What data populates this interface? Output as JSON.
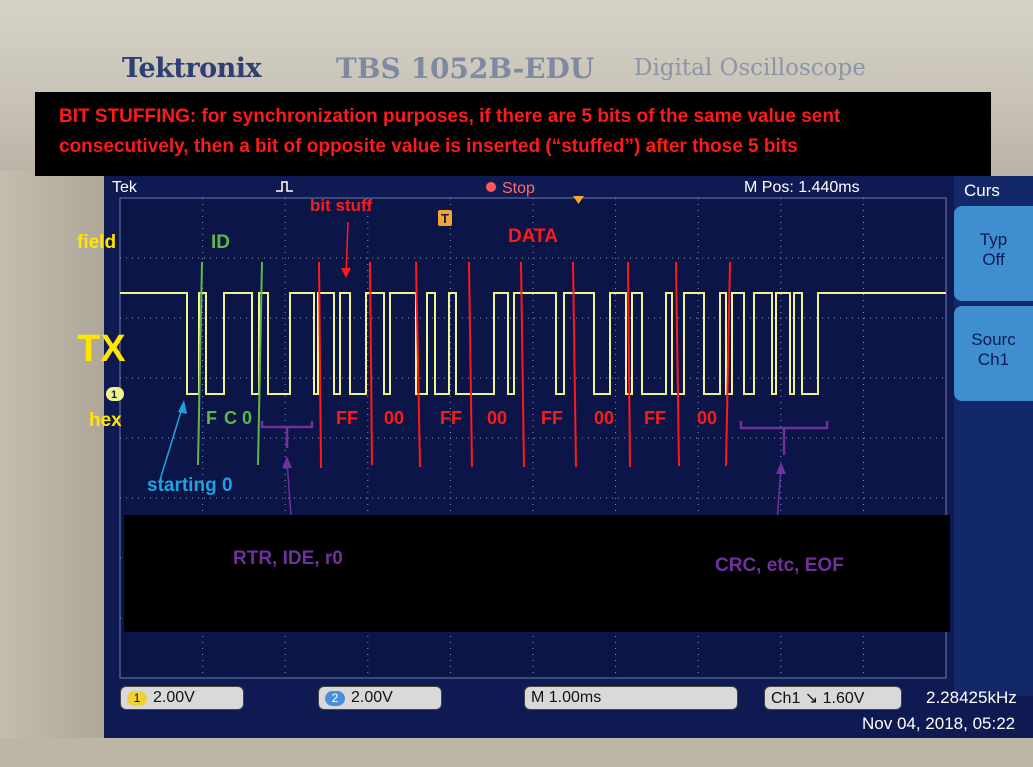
{
  "instrument": {
    "brand": "Tektronix",
    "model": "TBS 1052B-EDU",
    "product": "Digital Oscilloscope"
  },
  "note": {
    "line1": "BIT STUFFING: for synchronization purposes, if there are 5 bits of the same value sent",
    "line2": "consecutively, then a bit of opposite value is inserted (“stuffed”) after those 5 bits"
  },
  "screen": {
    "brand_short": "Tek",
    "run_state": "Stop",
    "m_pos": "M Pos: 1.440ms",
    "trigger_marker": "T",
    "channel_marker": "1",
    "menu": {
      "title": "Curs",
      "type_label": "Typ",
      "type_value": "Off",
      "source_label": "Sourc",
      "source_value": "Ch1"
    },
    "bottom": {
      "ch1_badge": "1",
      "ch1_scale": "2.00V",
      "ch2_badge": "2",
      "ch2_scale": "2.00V",
      "timebase": "M 1.00ms",
      "trigger": "Ch1 ↘ 1.60V",
      "frequency": "2.28425kHz",
      "datetime": "Nov 04, 2018, 05:22"
    }
  },
  "annotations": {
    "field": "field",
    "tx": "TX",
    "hex": "hex",
    "id": "ID",
    "bit_stuff": "bit stuff",
    "data": "DATA",
    "id_hex": [
      "F",
      "C",
      "0"
    ],
    "data_bytes": [
      "FF",
      "00",
      "FF",
      "00",
      "FF",
      "00",
      "FF",
      "00"
    ],
    "starting_bit": "starting 0",
    "rtr": "RTR, IDE, r0",
    "crc": "CRC, etc, EOF"
  },
  "colors": {
    "note_text": "#ff1a1a",
    "trace": "#f2f28c",
    "id_marker": "#5fb845",
    "data_marker": "#ff1a1a",
    "purple": "#7030a0",
    "field_label": "#ffe600",
    "starting_arrow": "#1fa3e0"
  }
}
